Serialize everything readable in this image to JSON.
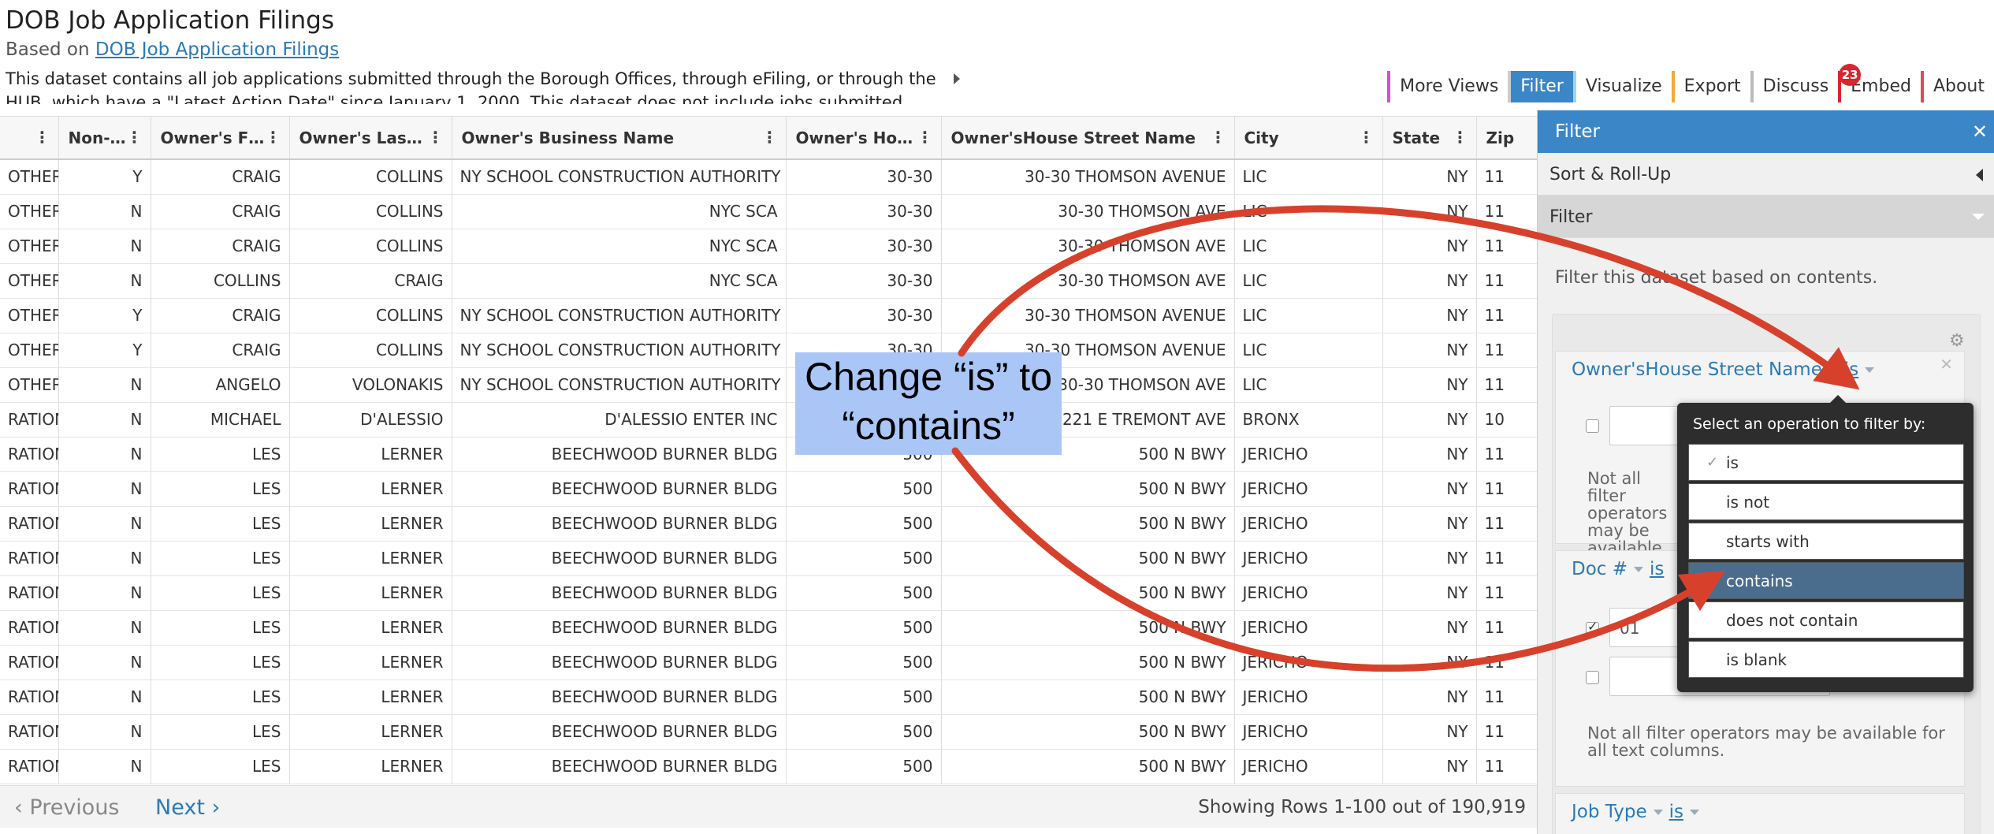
{
  "header": {
    "title": "DOB Job Application Filings",
    "based_on_prefix": "Based on ",
    "based_on_link": "DOB Job Application Filings",
    "description": "This dataset contains all job applications submitted through the Borough Offices, through eFiling, or through the HUB, which have a \"Latest Action Date\" since January 1, 2000. This dataset does not include jobs submitted through DOB NOW."
  },
  "toolbar": {
    "more_views": "More Views",
    "filter": "Filter",
    "visualize": "Visualize",
    "export": "Export",
    "discuss": "Discuss",
    "discuss_badge": "23",
    "embed": "Embed",
    "about": "About",
    "colors": {
      "more_views": "#d44fd4",
      "visualize": "#9ad6f2",
      "export": "#f2a93b",
      "discuss": "#bbbbbb",
      "embed": "#d9262e",
      "about": "#d44f5a"
    }
  },
  "grid": {
    "columns": [
      "",
      "Non-...",
      "Owner's Fir...",
      "Owner's Last ...",
      "Owner's Business Name",
      "Owner's Hous...",
      "Owner'sHouse Street Name",
      "City",
      "State",
      "Zip"
    ],
    "rows": [
      [
        "OTHER",
        "Y",
        "CRAIG",
        "COLLINS",
        "NY SCHOOL CONSTRUCTION AUTHORITY",
        "30-30",
        "30-30 THOMSON AVENUE",
        "LIC",
        "NY",
        "11"
      ],
      [
        "OTHER",
        "N",
        "CRAIG",
        "COLLINS",
        "NYC SCA",
        "30-30",
        "30-30 THOMSON AVE",
        "LIC",
        "NY",
        "11"
      ],
      [
        "OTHER",
        "N",
        "CRAIG",
        "COLLINS",
        "NYC SCA",
        "30-30",
        "30-30 THOMSON AVE",
        "LIC",
        "NY",
        "11"
      ],
      [
        "OTHER",
        "N",
        "COLLINS",
        "CRAIG",
        "NYC SCA",
        "30-30",
        "30-30 THOMSON AVE",
        "LIC",
        "NY",
        "11"
      ],
      [
        "OTHER",
        "Y",
        "CRAIG",
        "COLLINS",
        "NY SCHOOL CONSTRUCTION AUTHORITY",
        "30-30",
        "30-30 THOMSON AVENUE",
        "LIC",
        "NY",
        "11"
      ],
      [
        "OTHER",
        "Y",
        "CRAIG",
        "COLLINS",
        "NY SCHOOL CONSTRUCTION AUTHORITY",
        "30-30",
        "30-30 THOMSON AVENUE",
        "LIC",
        "NY",
        "11"
      ],
      [
        "OTHER",
        "N",
        "ANGELO",
        "VOLONAKIS",
        "NY SCHOOL CONSTRUCTION AUTHORITY",
        "30-30",
        "30-30 THOMSON AVE",
        "LIC",
        "NY",
        "11"
      ],
      [
        "RATION",
        "N",
        "MICHAEL",
        "D'ALESSIO",
        "D'ALESSIO ENTER INC",
        "3221",
        "3221 E TREMONT AVE",
        "BRONX",
        "NY",
        "10"
      ],
      [
        "RATION",
        "N",
        "LES",
        "LERNER",
        "BEECHWOOD BURNER BLDG",
        "500",
        "500 N BWY",
        "JERICHO",
        "NY",
        "11"
      ],
      [
        "RATION",
        "N",
        "LES",
        "LERNER",
        "BEECHWOOD BURNER BLDG",
        "500",
        "500 N BWY",
        "JERICHO",
        "NY",
        "11"
      ],
      [
        "RATION",
        "N",
        "LES",
        "LERNER",
        "BEECHWOOD BURNER BLDG",
        "500",
        "500 N BWY",
        "JERICHO",
        "NY",
        "11"
      ],
      [
        "RATION",
        "N",
        "LES",
        "LERNER",
        "BEECHWOOD BURNER BLDG",
        "500",
        "500 N BWY",
        "JERICHO",
        "NY",
        "11"
      ],
      [
        "RATION",
        "N",
        "LES",
        "LERNER",
        "BEECHWOOD BURNER BLDG",
        "500",
        "500 N BWY",
        "JERICHO",
        "NY",
        "11"
      ],
      [
        "RATION",
        "N",
        "LES",
        "LERNER",
        "BEECHWOOD BURNER BLDG",
        "500",
        "500 N BWY",
        "JERICHO",
        "NY",
        "11"
      ],
      [
        "RATION",
        "N",
        "LES",
        "LERNER",
        "BEECHWOOD BURNER BLDG",
        "500",
        "500 N BWY",
        "JERICHO",
        "NY",
        "11"
      ],
      [
        "RATION",
        "N",
        "LES",
        "LERNER",
        "BEECHWOOD BURNER BLDG",
        "500",
        "500 N BWY",
        "JERICHO",
        "NY",
        "11"
      ],
      [
        "RATION",
        "N",
        "LES",
        "LERNER",
        "BEECHWOOD BURNER BLDG",
        "500",
        "500 N BWY",
        "JERICHO",
        "NY",
        "11"
      ],
      [
        "RATION",
        "N",
        "LES",
        "LERNER",
        "BEECHWOOD BURNER BLDG",
        "500",
        "500 N BWY",
        "JERICHO",
        "NY",
        "11"
      ]
    ]
  },
  "pagination": {
    "previous": "Previous",
    "next": "Next",
    "showing": "Showing Rows 1-100 out of 190,919"
  },
  "sidebar": {
    "title": "Filter",
    "close_icon": "close-icon",
    "sort_rollup": "Sort & Roll-Up",
    "filter_section": "Filter",
    "description": "Filter this dataset based on contents.",
    "filters": [
      {
        "column": "Owner'sHouse Street Name",
        "operator": "is",
        "value": "",
        "note": "Not all filter operators may be available for all text columns."
      },
      {
        "column": "Doc #",
        "operator": "is",
        "value": "01",
        "value2": "",
        "note": "Not all filter operators may be available for all text columns."
      },
      {
        "column": "Job Type",
        "operator": "is"
      }
    ]
  },
  "operator_popup": {
    "title": "Select an operation to filter by:",
    "selected": "is",
    "highlighted": "contains",
    "options": [
      "is",
      "is not",
      "starts with",
      "contains",
      "does not contain",
      "is blank"
    ]
  },
  "annotation": {
    "text": "Change “is” to “contains”",
    "color": "#d7412c"
  }
}
